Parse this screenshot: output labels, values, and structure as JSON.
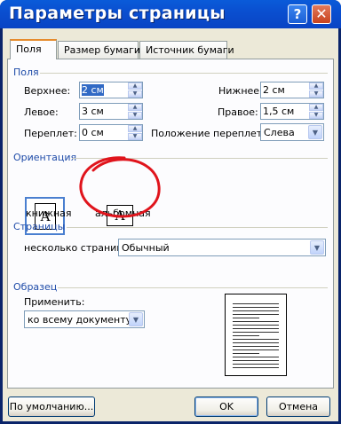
{
  "window": {
    "title": "Параметры страницы",
    "help_glyph": "?",
    "close_glyph": "✕"
  },
  "tabs": [
    {
      "label": "Поля",
      "active": true
    },
    {
      "label": "Размер бумаги"
    },
    {
      "label": "Источник бумаги"
    }
  ],
  "margins": {
    "section_title": "Поля",
    "top": {
      "label": "Верхнее:",
      "value": "2 см"
    },
    "bottom": {
      "label": "Нижнее:",
      "value": "2 см"
    },
    "left": {
      "label": "Левое:",
      "value": "3 см"
    },
    "right": {
      "label": "Правое:",
      "value": "1,5 см"
    },
    "gutter": {
      "label": "Переплет:",
      "value": "0 см"
    },
    "gutter_pos": {
      "label": "Положение переплета:",
      "value": "Слева"
    }
  },
  "orientation": {
    "section_title": "Ориентация",
    "portrait_label": "книжная",
    "landscape_label": "альбомная",
    "glyph": "A"
  },
  "pages": {
    "section_title": "Страницы",
    "multiple_label": "несколько страниц:",
    "multiple_value": "Обычный"
  },
  "sample": {
    "section_title": "Образец",
    "apply_label": "Применить:",
    "apply_value": "ко всему документу"
  },
  "footer": {
    "default_label": "По умолчанию...",
    "ok_label": "OK",
    "cancel_label": "Отмена"
  },
  "colors": {
    "title_bar": "#0a4fd0",
    "section_title": "#1e4ba8",
    "annotation": "#e0141c",
    "dialog_bg": "#ece9d8"
  }
}
